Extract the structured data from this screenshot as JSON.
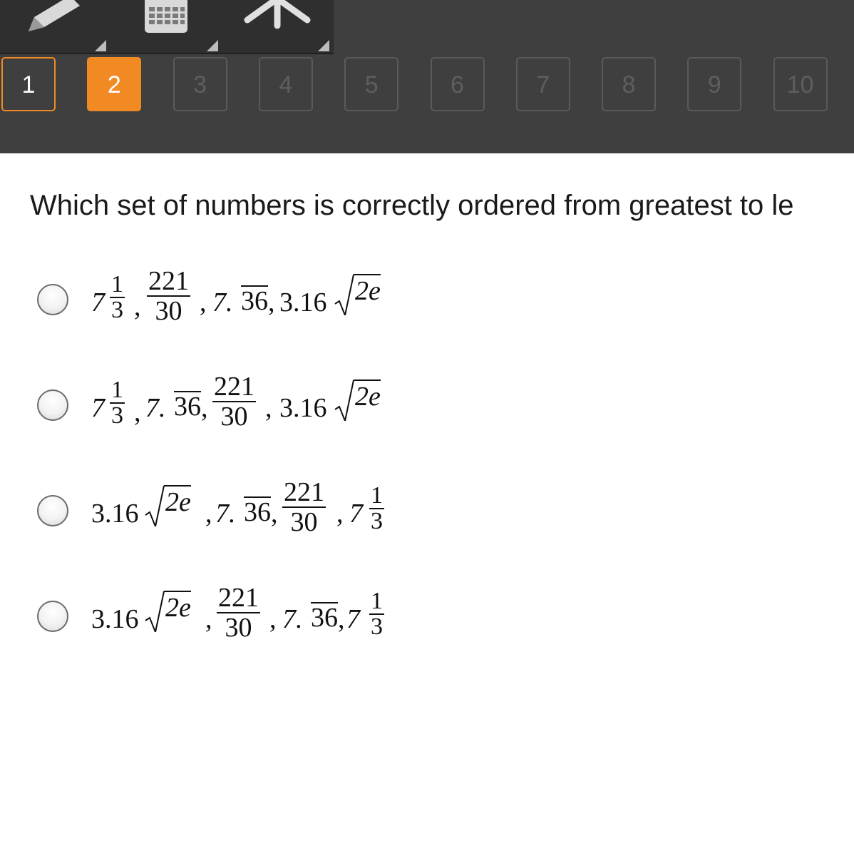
{
  "toolbar": {
    "tools": [
      {
        "icon": "pencil-icon"
      },
      {
        "icon": "calculator-icon"
      },
      {
        "icon": "pointer-tool-icon"
      }
    ]
  },
  "question_nav": {
    "numbers": [
      "1",
      "2",
      "3",
      "4",
      "5",
      "6",
      "7",
      "8",
      "9",
      "10"
    ],
    "current": "2",
    "visited": [
      "1"
    ]
  },
  "question": {
    "text": "Which set of numbers is correctly ordered from greatest to le"
  },
  "choices": [
    {
      "label": "7 1/3, 221/30, 7.36 (repeating), 3.16√2e",
      "parts": {
        "whole": "7",
        "num1": "1",
        "den1": "3",
        "c1": ",",
        "num2": "221",
        "den2": "30",
        "c2": ",",
        "dec_int": "7.",
        "rep": "36",
        "c3": ",",
        "coef": "3.16",
        "rad": "2e"
      }
    },
    {
      "label": "7 1/3, 7.36 (repeating), 221/30, 3.16√2e",
      "parts": {
        "whole": "7",
        "num1": "1",
        "den1": "3",
        "c1": ",",
        "dec_int": "7.",
        "rep": "36",
        "c2": ",",
        "num2": "221",
        "den2": "30",
        "c3": ",",
        "coef": "3.16",
        "rad": "2e"
      }
    },
    {
      "label": "3.16√2e, 7.36 (repeating), 221/30, 7 1/3",
      "parts": {
        "coef": "3.16",
        "rad": "2e",
        "c1": ",",
        "dec_int": "7.",
        "rep": "36",
        "c2": ",",
        "num2": "221",
        "den2": "30",
        "c3": ",",
        "whole": "7",
        "num1": "1",
        "den1": "3"
      }
    },
    {
      "label": "3.16√2e, 221/30, 7.36 (repeating), 7 1/3",
      "parts": {
        "coef": "3.16",
        "rad": "2e",
        "c1": ",",
        "num2": "221",
        "den2": "30",
        "c2": ",",
        "dec_int": "7.",
        "rep": "36",
        "c3": ",",
        "whole": "7",
        "num1": "1",
        "den1": "3"
      }
    }
  ]
}
